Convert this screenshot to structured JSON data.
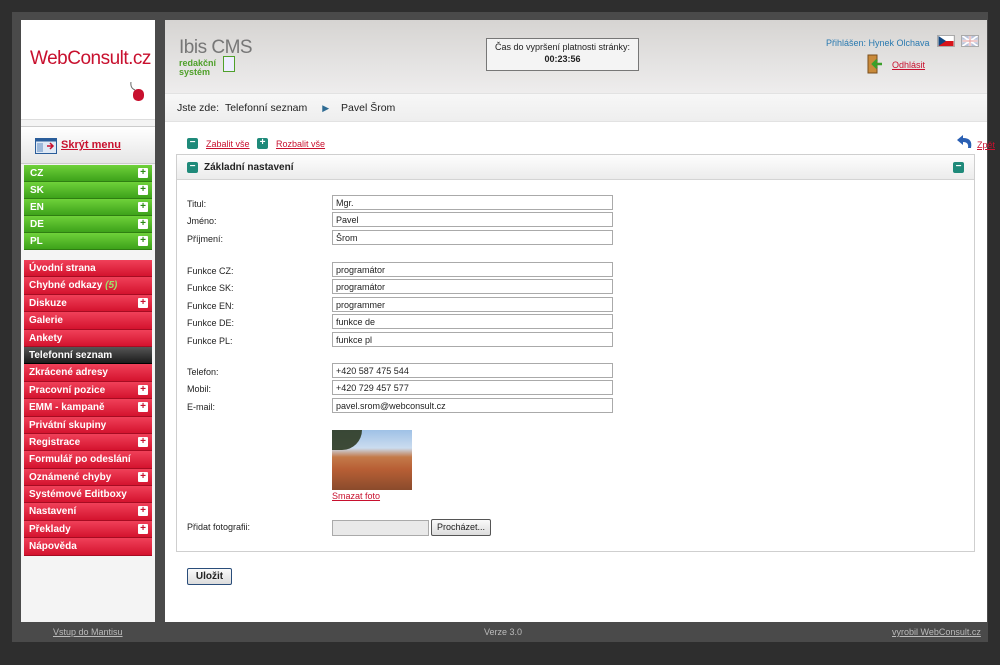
{
  "sidebar": {
    "logo_text": "WebConsult.cz",
    "hide_menu": "Skrýt menu",
    "languages": [
      {
        "label": "CZ"
      },
      {
        "label": "SK"
      },
      {
        "label": "EN"
      },
      {
        "label": "DE"
      },
      {
        "label": "PL"
      }
    ],
    "menu": [
      {
        "label": "Úvodní strana",
        "plus": false
      },
      {
        "label": "Chybné odkazy",
        "count": "(5)",
        "plus": false
      },
      {
        "label": "Diskuze",
        "plus": true
      },
      {
        "label": "Galerie",
        "plus": false
      },
      {
        "label": "Ankety",
        "plus": false
      },
      {
        "label": "Telefonní seznam",
        "plus": false,
        "active": true
      },
      {
        "label": "Zkrácené adresy",
        "plus": false
      },
      {
        "label": "Pracovní pozice",
        "plus": true
      },
      {
        "label": "EMM - kampaně",
        "plus": true
      },
      {
        "label": "Privátní skupiny",
        "plus": false
      },
      {
        "label": "Registrace",
        "plus": true
      },
      {
        "label": "Formulář po odeslání",
        "plus": false
      },
      {
        "label": "Oznámené chyby",
        "plus": true
      },
      {
        "label": "Systémové Editboxy",
        "plus": false
      },
      {
        "label": "Nastavení",
        "plus": true
      },
      {
        "label": "Překlady",
        "plus": true
      },
      {
        "label": "Nápověda",
        "plus": false
      }
    ]
  },
  "header": {
    "cms_title": "Ibis CMS",
    "cms_sub_1": "redakční",
    "cms_sub_2": "systém",
    "timer_label": "Čas do vypršení platnosti stránky:",
    "timer_value": "00:23:56",
    "user_label": "Přihlášen: Hynek Olchava",
    "logout": "Odhlásit"
  },
  "breadcrumb": {
    "prefix": "Jste zde:",
    "items": [
      "Telefonní seznam",
      "Pavel Šrom"
    ]
  },
  "toolbar": {
    "collapse_all": "Zabalit vše",
    "expand_all": "Rozbalit vše",
    "back": "Zpět"
  },
  "panel": {
    "title": "Základní nastavení",
    "fields": [
      {
        "label": "Titul:",
        "value": "Mgr."
      },
      {
        "label": "Jméno:",
        "value": "Pavel"
      },
      {
        "label": "Příjmení:",
        "value": "Šrom"
      },
      {
        "label": "Funkce CZ:",
        "value": "programátor"
      },
      {
        "label": "Funkce SK:",
        "value": "programátor"
      },
      {
        "label": "Funkce EN:",
        "value": "programmer"
      },
      {
        "label": "Funkce DE:",
        "value": "funkce de"
      },
      {
        "label": "Funkce PL:",
        "value": "funkce pl"
      },
      {
        "label": "Telefon:",
        "value": "+420 587 475 544"
      },
      {
        "label": "Mobil:",
        "value": "+420 729 457 577"
      },
      {
        "label": "E-mail:",
        "value": "pavel.srom@webconsult.cz"
      }
    ],
    "delete_photo": "Smazat foto",
    "add_photo_label": "Přidat fotografii:",
    "browse": "Procházet..."
  },
  "save": "Uložit",
  "footer": {
    "left": "Vstup do Mantisu",
    "middle": "Verze 3.0",
    "right": "vyrobil WebConsult.cz"
  }
}
